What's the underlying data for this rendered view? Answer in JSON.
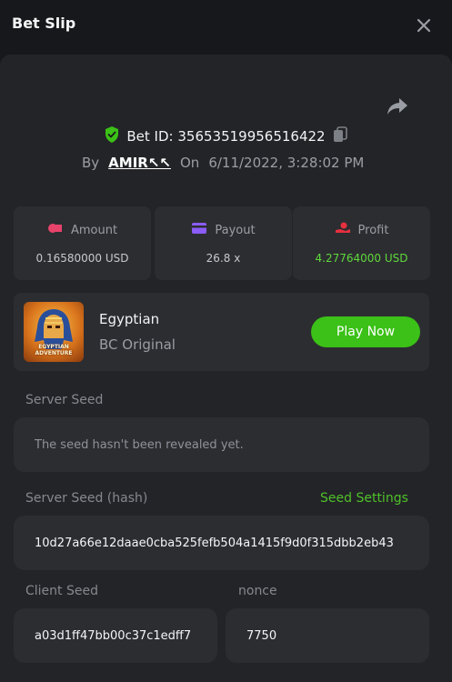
{
  "header": {
    "title": "Bet Slip"
  },
  "bet": {
    "id_label": "Bet ID: 35653519956516422",
    "by_label": "By",
    "user": "AMIR↖↖",
    "on_label": "On",
    "datetime": "6/11/2022, 3:28:02 PM"
  },
  "stats": {
    "amount": {
      "label": "Amount",
      "value": "0.16580000 USD"
    },
    "payout": {
      "label": "Payout",
      "value": "26.8 x"
    },
    "profit": {
      "label": "Profit",
      "value": "4.27764000 USD"
    }
  },
  "game": {
    "name": "Egyptian",
    "provider": "BC Original",
    "thumb_caption": "EGYPTIAN ADVENTURE",
    "play_label": "Play Now"
  },
  "seeds": {
    "server_seed_label": "Server Seed",
    "server_seed_placeholder": "The seed hasn't been revealed yet.",
    "server_hash_label": "Server Seed (hash)",
    "seed_settings_label": "Seed Settings",
    "server_hash_value": "10d27a66e12daae0cba525fefb504a1415f9d0f315dbb2eb43",
    "client_seed_label": "Client Seed",
    "client_seed_value": "a03d1ff47bb00c37c1edff7",
    "nonce_label": "nonce",
    "nonce_value": "7750"
  },
  "colors": {
    "accent_green": "#3bc117",
    "profit_green": "#5fd83b",
    "amount_icon": "#e8436b",
    "payout_icon": "#8b5cf6",
    "profit_icon": "#e5303f"
  }
}
